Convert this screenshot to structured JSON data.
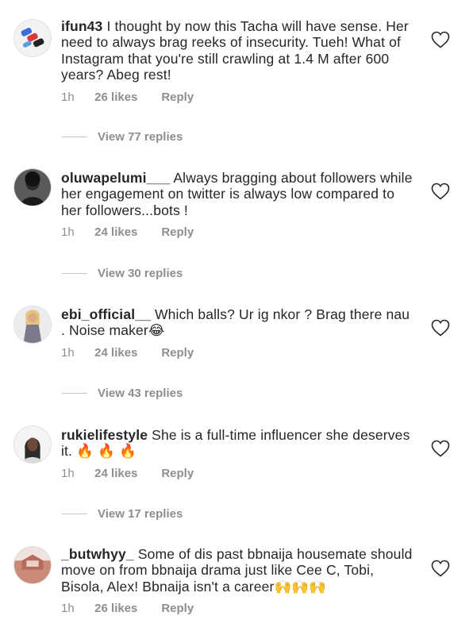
{
  "comments": [
    {
      "username": "ifun43",
      "text": "I thought by now this Tacha will have sense. Her need to always brag reeks of insecurity. Tueh! What of Instagram that you're still crawling at 1.4 M after 600 years? Abeg rest!",
      "time": "1h",
      "likes": "26 likes",
      "reply": "Reply",
      "view_replies": "View 77 replies"
    },
    {
      "username": "oluwapelumi___",
      "text": "Always bragging about followers while her engagement on twitter is always low compared to her followers...bots !",
      "time": "1h",
      "likes": "24 likes",
      "reply": "Reply",
      "view_replies": "View 30 replies"
    },
    {
      "username": "ebi_official__",
      "text": "Which balls? Ur ig nkor ? Brag there nau . Noise maker😂",
      "time": "1h",
      "likes": "24 likes",
      "reply": "Reply",
      "view_replies": "View 43 replies"
    },
    {
      "username": "rukielifestyle",
      "text": "She is a full-time influencer she deserves it. 🔥 🔥 🔥",
      "time": "1h",
      "likes": "24 likes",
      "reply": "Reply",
      "view_replies": "View 17 replies"
    },
    {
      "username": "_butwhyy_",
      "text": "Some of dis past bbnaija housemate should move on from bbnaija drama just like Cee C, Tobi, Bisola, Alex! Bbnaija isn't a career🙌🙌🙌",
      "time": "1h",
      "likes": "26 likes",
      "reply": "Reply"
    }
  ],
  "icons": {
    "heart": "heart-outline-icon",
    "avatar": "avatar"
  },
  "colors": {
    "text": "#262626",
    "secondary": "#8e8e8e",
    "divider": "#c7c7c7"
  }
}
